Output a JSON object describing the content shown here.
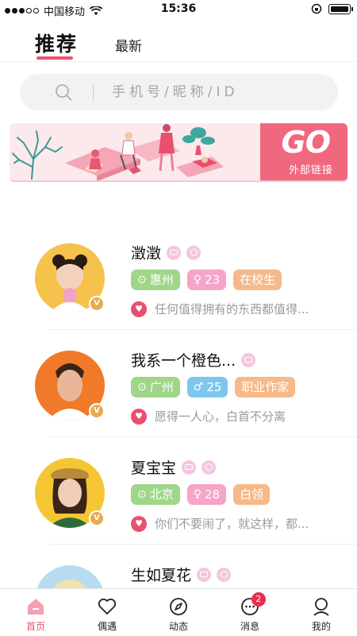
{
  "status_bar": {
    "carrier": "中国移动",
    "time": "15:36"
  },
  "tabs": [
    {
      "label": "推荐",
      "active": true
    },
    {
      "label": "最新",
      "active": false
    }
  ],
  "search": {
    "placeholder": "手机号/昵称/ID"
  },
  "banner": {
    "go_text": "GO",
    "link_text": "外部链接"
  },
  "users": [
    {
      "name": "澂澂",
      "location": "惠州",
      "age": "23",
      "gender": "female",
      "status": "在校生",
      "quote": "任何值得拥有的东西都值得...",
      "avatar_bg": "#f5c24c"
    },
    {
      "name": "我系一个橙色...",
      "location": "广州",
      "age": "25",
      "gender": "male",
      "status": "职业作家",
      "quote": "愿得一人心，白首不分离",
      "avatar_bg": "#f07a2a"
    },
    {
      "name": "夏宝宝",
      "location": "北京",
      "age": "28",
      "gender": "female",
      "status": "白领",
      "quote": "你们不要闹了，就这样，都...",
      "avatar_bg": "#f5c633"
    },
    {
      "name": "生如夏花",
      "location": "",
      "age": "",
      "gender": "female",
      "status": "",
      "quote": "",
      "avatar_bg": "#b8dcef"
    }
  ],
  "bottom_nav": [
    {
      "label": "首页",
      "icon": "home-icon",
      "active": true
    },
    {
      "label": "偶遇",
      "icon": "heart-icon",
      "active": false
    },
    {
      "label": "动态",
      "icon": "compass-icon",
      "active": false
    },
    {
      "label": "消息",
      "icon": "chat-icon",
      "active": false,
      "badge": "2"
    },
    {
      "label": "我的",
      "icon": "profile-icon",
      "active": false
    }
  ],
  "colors": {
    "accent": "#e8516e",
    "location_tag": "#9fd68a",
    "female_tag": "#f4a5c8",
    "male_tag": "#7ec7ec",
    "job_tag": "#f5b98a"
  }
}
